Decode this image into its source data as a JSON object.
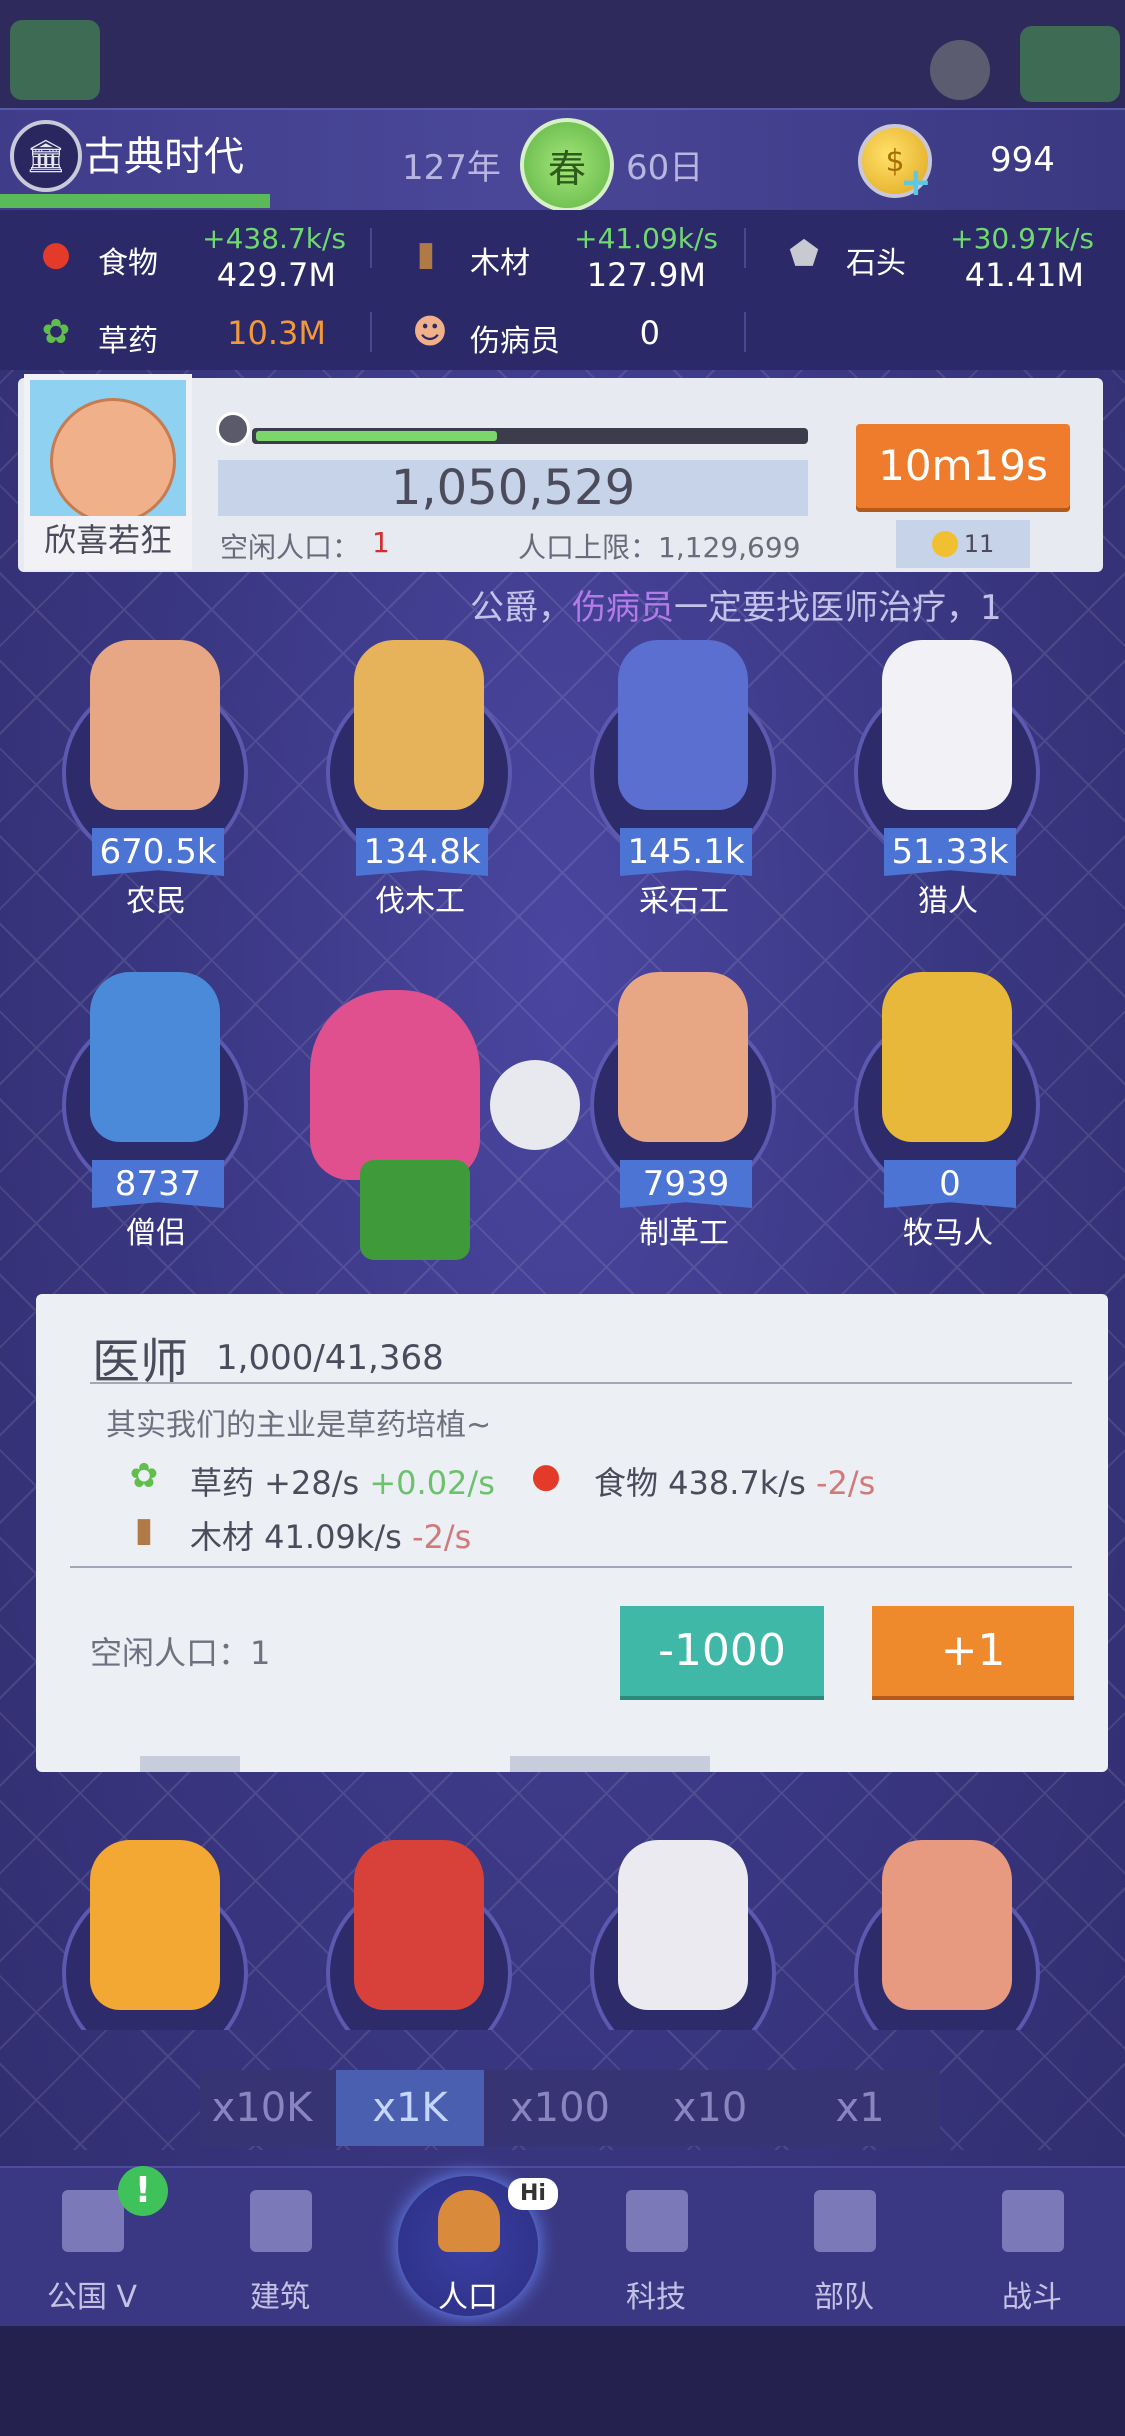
{
  "header": {
    "era_name": "古典时代",
    "year": "127年",
    "season": "春",
    "day": "60日",
    "coins": "994"
  },
  "resources": [
    {
      "icon": "apple-icon",
      "name": "食物",
      "rate": "+438.7k/s",
      "value": "429.7M"
    },
    {
      "icon": "wood-icon",
      "name": "木材",
      "rate": "+41.09k/s",
      "value": "127.9M"
    },
    {
      "icon": "stone-icon",
      "name": "石头",
      "rate": "+30.97k/s",
      "value": "41.41M"
    },
    {
      "icon": "herb-icon",
      "name": "草药",
      "value": "10.3M"
    },
    {
      "icon": "wounded-icon",
      "name": "伤病员",
      "value": "0"
    }
  ],
  "profile": {
    "mood": "欣喜若狂",
    "population": "1,050,529",
    "progress": 0.44,
    "idle_label": "空闲人口：",
    "idle_value": "1",
    "cap_label": "人口上限：1,129,699",
    "timer": "10m19s",
    "timer_cost": "11"
  },
  "ticker": {
    "prefix": "公爵，",
    "highlight": "伤病员",
    "suffix": "一定要找医师治疗，1"
  },
  "professions": [
    {
      "name": "农民",
      "count": "670.5k"
    },
    {
      "name": "伐木工",
      "count": "134.8k"
    },
    {
      "name": "采石工",
      "count": "145.1k"
    },
    {
      "name": "猎人",
      "count": "51.33k"
    },
    {
      "name": "僧侣",
      "count": "8737"
    },
    {
      "name": "制革工",
      "count": "7939"
    },
    {
      "name": "牧马人",
      "count": "0"
    }
  ],
  "panel": {
    "title": "医师",
    "count": "1,000/41,368",
    "description": "其实我们的主业是草药培植~",
    "effects": [
      {
        "icon": "herb-icon",
        "label": "草药 +28/s ",
        "delta": "+0.02/s"
      },
      {
        "icon": "apple-icon",
        "label": "食物 438.7k/s ",
        "delta": "-2/s"
      },
      {
        "icon": "wood-icon",
        "label": "木材 41.09k/s ",
        "delta": "-2/s"
      }
    ],
    "idle": "空闲人口：1",
    "minus_label": "-1000",
    "plus_label": "+1"
  },
  "multipliers": [
    "x10K",
    "x1K",
    "x100",
    "x10",
    "x1"
  ],
  "multiplier_selected": "x1K",
  "nav": [
    {
      "label": "公国 V",
      "icon": "castle-icon"
    },
    {
      "label": "建筑",
      "icon": "house-icon"
    },
    {
      "label": "人口",
      "icon": "person-icon"
    },
    {
      "label": "科技",
      "icon": "book-icon"
    },
    {
      "label": "部队",
      "icon": "banner-icon"
    },
    {
      "label": "战斗",
      "icon": "swords-icon"
    }
  ],
  "nav_alert": "!",
  "nav_bubble": "Hi"
}
